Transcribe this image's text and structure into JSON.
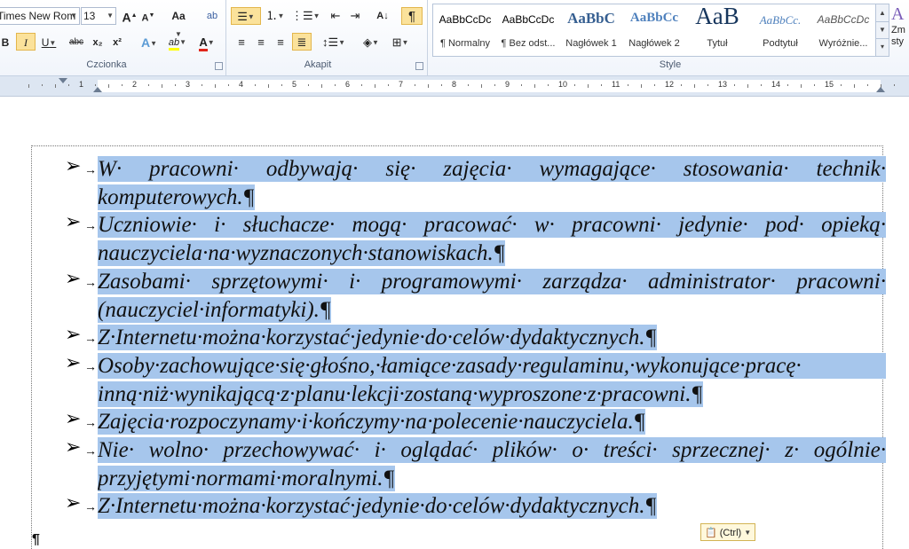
{
  "ribbon": {
    "font": {
      "name": "Times New Rom",
      "size": "13",
      "grow": "A",
      "shrink": "A",
      "case": "Aa",
      "clear": "ab",
      "bold": "B",
      "italic": "I",
      "underline": "U",
      "strike": "abc",
      "sub": "x₂",
      "sup": "x²",
      "effects": "A",
      "highlight": "ab",
      "color": "A",
      "group_label": "Czcionka"
    },
    "paragraph": {
      "group_label": "Akapit",
      "pilcrow": "¶",
      "sort": "A↓"
    },
    "styles": {
      "group_label": "Style",
      "items": [
        {
          "preview": "AaBbCcDc",
          "name": "¶ Normalny"
        },
        {
          "preview": "AaBbCcDc",
          "name": "¶ Bez odst..."
        },
        {
          "preview": "AaBbC",
          "name": "Nagłówek 1"
        },
        {
          "preview": "AaBbCc",
          "name": "Nagłówek 2"
        },
        {
          "preview": "AaB",
          "name": "Tytuł"
        },
        {
          "preview": "AaBbCc.",
          "name": "Podtytuł"
        },
        {
          "preview": "AaBbCcDc",
          "name": "Wyróżnie..."
        }
      ],
      "change": "Zm sty"
    }
  },
  "ruler": {
    "numbers": [
      "1",
      "1",
      "2",
      "3",
      "4",
      "5",
      "6",
      "7",
      "8",
      "9",
      "10",
      "11",
      "12",
      "13",
      "14",
      "15"
    ]
  },
  "document": {
    "bullet_glyph": "➢",
    "tab_glyph": "→",
    "items": [
      {
        "lines": [
          "W· pracowni· odbywają· się· zajęcia· wymagające· stosowania· technik·",
          "komputerowych.¶"
        ]
      },
      {
        "lines": [
          "Uczniowie· i· słuchacze· mogą· pracować· w· pracowni· jedynie· pod· opieką·",
          "nauczyciela·na·wyznaczonych·stanowiskach.¶"
        ]
      },
      {
        "lines": [
          "Zasobami· sprzętowymi· i· programowymi· zarządza· administrator· pracowni·",
          "(nauczyciel·informatyki).¶"
        ]
      },
      {
        "lines": [
          "Z·Internetu·można·korzystać·jedynie·do·celów·dydaktycznych.¶"
        ]
      },
      {
        "lines": [
          "Osoby·zachowujące·się·głośno,·łamiące·zasady·regulaminu,·wykonujące·pracę·",
          "inną·niż·wynikającą·z·planu·lekcji·zostaną·wyproszone·z·pracowni.¶"
        ]
      },
      {
        "lines": [
          "Zajęcia·rozpoczynamy·i·kończymy·na·polecenie·nauczyciela.¶"
        ]
      },
      {
        "lines": [
          "Nie· wolno· przechowywać· i· oglądać· plików· o· treści· sprzecznej· z· ogólnie·",
          "przyjętymi·normami·moralnymi.¶"
        ]
      },
      {
        "lines": [
          "Z·Internetu·można·korzystać·jedynie·do·celów·dydaktycznych.¶"
        ]
      }
    ],
    "paste_options": "(Ctrl)",
    "end_mark": "¶"
  }
}
